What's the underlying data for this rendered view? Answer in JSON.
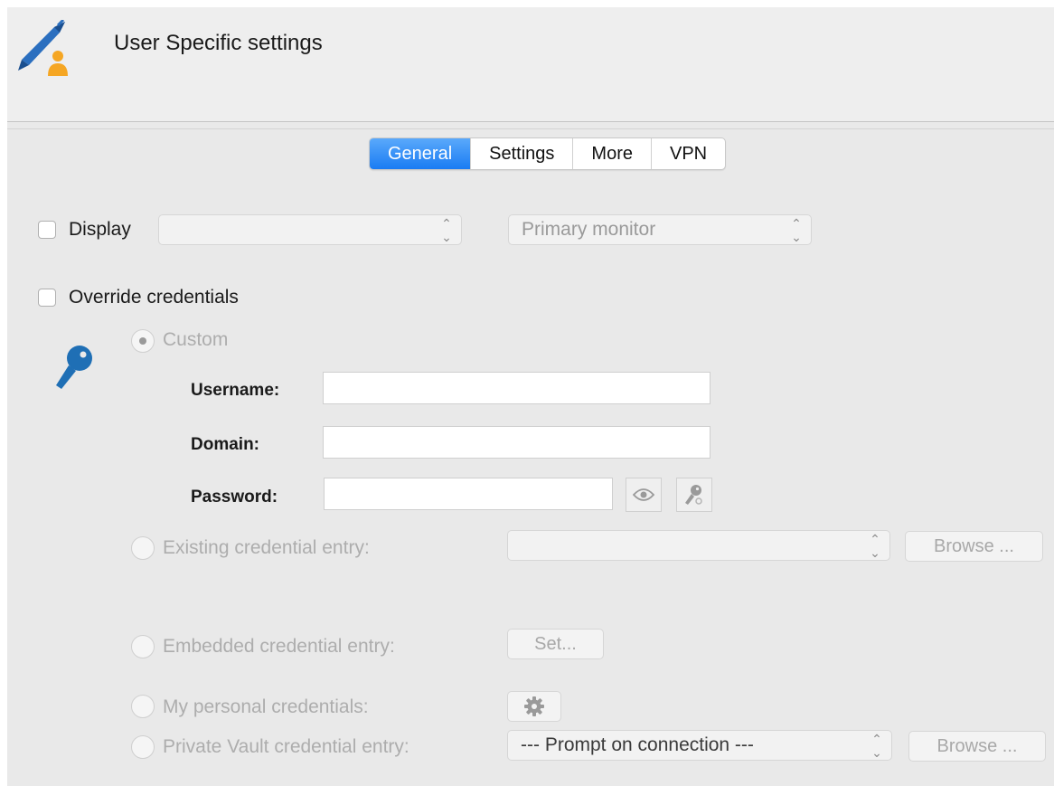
{
  "header": {
    "title": "User Specific settings",
    "icon": "pencil-user-icon"
  },
  "tabs": [
    {
      "label": "General",
      "active": true
    },
    {
      "label": "Settings",
      "active": false
    },
    {
      "label": "More",
      "active": false
    },
    {
      "label": "VPN",
      "active": false
    }
  ],
  "display": {
    "label": "Display",
    "checked": false,
    "select_value": "",
    "monitor_value": "Primary monitor"
  },
  "override": {
    "label": "Override credentials",
    "checked": false
  },
  "credentials": {
    "custom_label": "Custom",
    "username_label": "Username:",
    "username_value": "",
    "domain_label": "Domain:",
    "domain_value": "",
    "password_label": "Password:",
    "password_value": "",
    "existing_label": "Existing credential entry:",
    "existing_value": "",
    "existing_browse": "Browse ...",
    "embedded_label": "Embedded credential entry:",
    "embedded_set": "Set...",
    "personal_label": "My personal credentials:",
    "vault_label": "Private Vault credential entry:",
    "vault_value": "--- Prompt on connection ---",
    "vault_browse": "Browse ..."
  },
  "colors": {
    "accent": "#1a7cf3",
    "key_icon": "#1f6fb5",
    "user_icon": "#f5a623"
  }
}
